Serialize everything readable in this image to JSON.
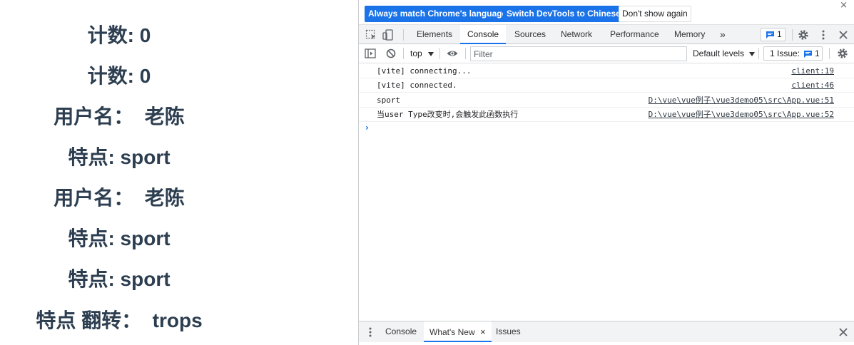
{
  "app": {
    "lines": [
      "计数: 0",
      "计数: 0",
      "用户名：  老陈",
      "特点: sport",
      "用户名：  老陈",
      "特点: sport",
      "特点: sport",
      "特点 翻转：  trops"
    ]
  },
  "devtools": {
    "infobar": {
      "match_language_label": "Always match Chrome's language",
      "switch_chinese_label": "Switch DevTools to Chinese",
      "dont_show_label": "Don't show again",
      "close_glyph": "×"
    },
    "tabs": [
      "Elements",
      "Console",
      "Sources",
      "Network",
      "Performance",
      "Memory"
    ],
    "active_tab": "Console",
    "more_tabs_glyph": "»",
    "issues_badge_count": "1",
    "console_toolbar": {
      "context": "top",
      "filter_placeholder": "Filter",
      "levels_label": "Default levels",
      "issues_label": "1 Issue:",
      "issues_count": "1"
    },
    "logs": [
      {
        "message": "[vite] connecting...",
        "source": "client:19"
      },
      {
        "message": "[vite] connected.",
        "source": "client:46"
      },
      {
        "message": "sport",
        "source": "D:\\vue\\vue例子\\vue3demo05\\src\\App.vue:51"
      },
      {
        "message": "当user Type改变时,会触发此函数执行",
        "source": "D:\\vue\\vue例子\\vue3demo05\\src\\App.vue:52"
      }
    ],
    "prompt_glyph": "›",
    "drawer": {
      "tabs": [
        "Console",
        "What's New",
        "Issues"
      ],
      "active_tab": "What's New",
      "tab_close_glyph": "×",
      "close_glyph": "×"
    },
    "icon_names": [
      "inspect-element-icon",
      "device-toolbar-icon",
      "settings-gear-icon",
      "kebab-menu-icon",
      "close-icon",
      "sidebar-toggle-icon",
      "clear-console-icon",
      "eye-icon",
      "chevron-down-icon",
      "message-icon"
    ],
    "colors": {
      "accent": "#1a73e8",
      "app_text": "#2c3e50",
      "toolbar_bg": "#f1f3f4"
    }
  }
}
